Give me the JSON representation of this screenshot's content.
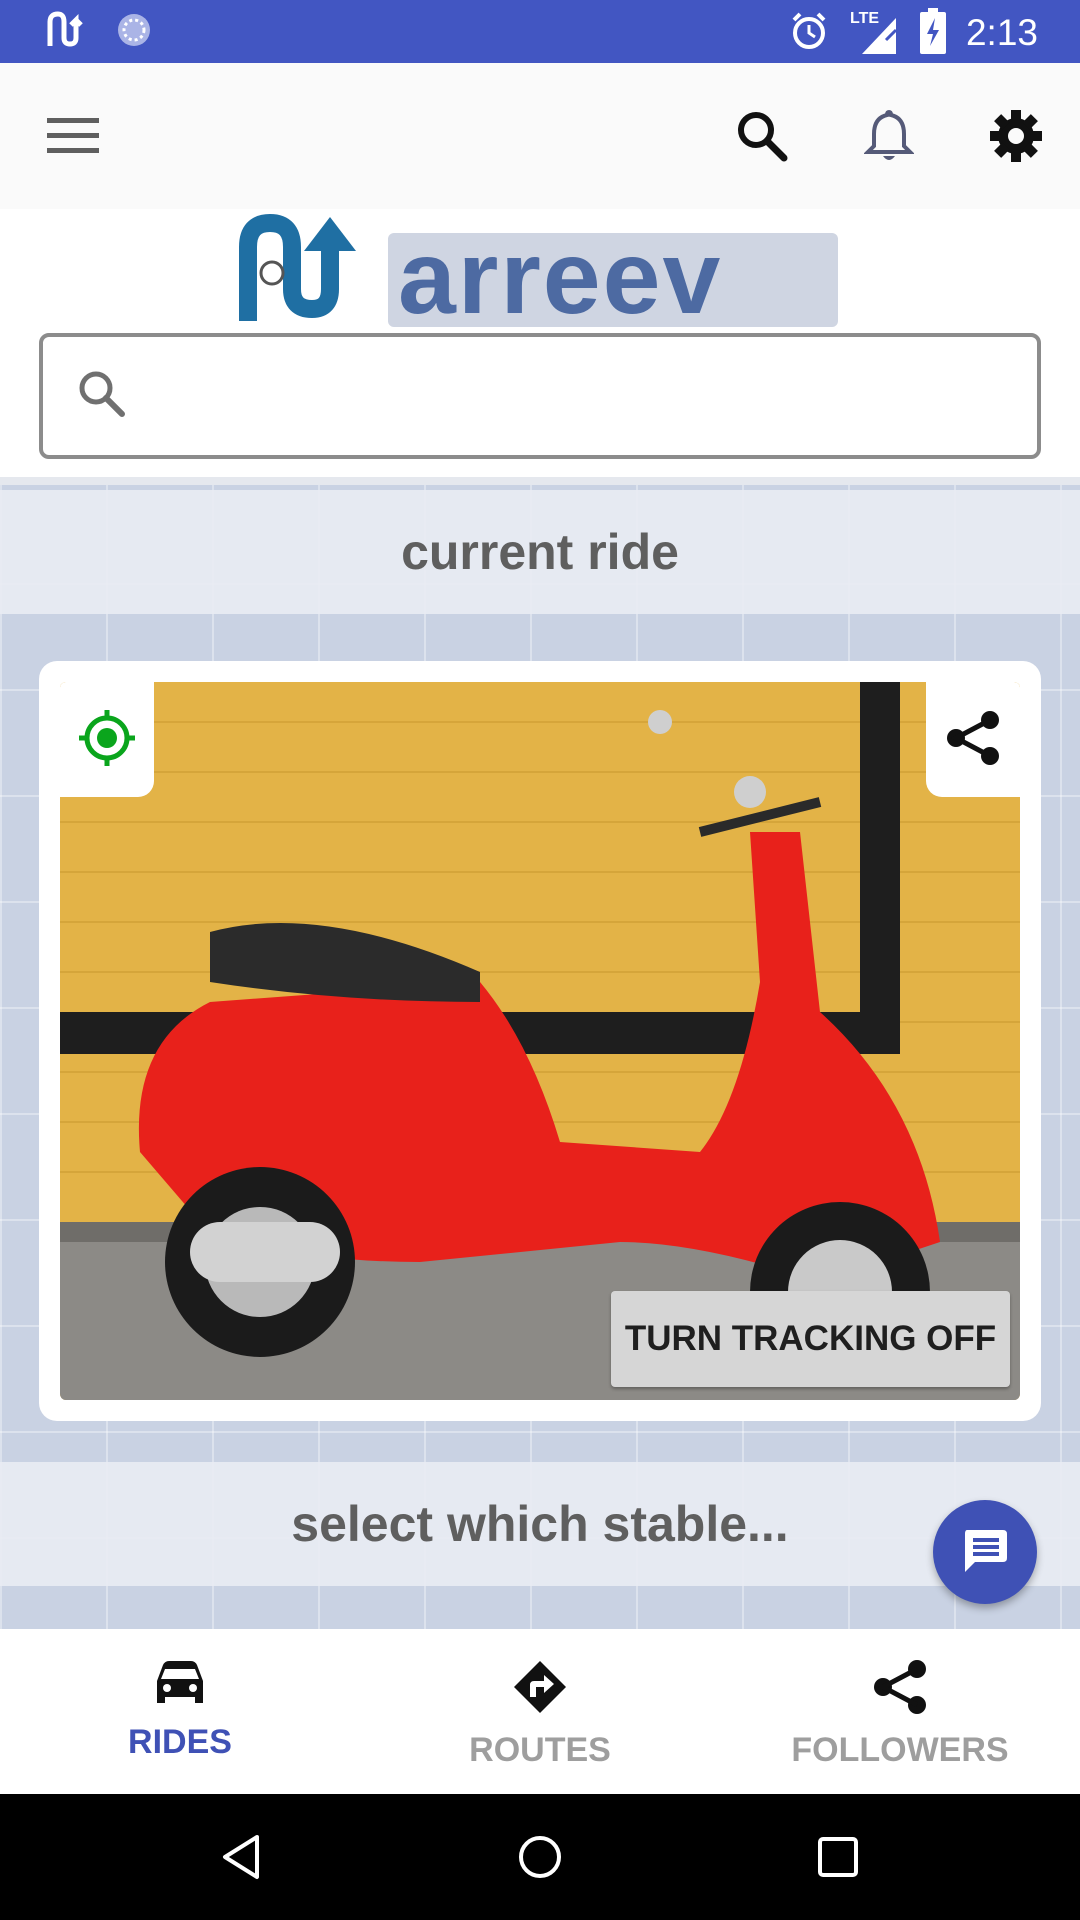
{
  "status_bar": {
    "time": "2:13",
    "network": "LTE",
    "icons": [
      "arreev-notification-icon",
      "sync-icon",
      "alarm-icon",
      "signal-icon",
      "battery-charging-icon"
    ]
  },
  "toolbar": {
    "icons": [
      "menu-icon",
      "search-icon",
      "bell-icon",
      "gear-icon"
    ]
  },
  "logo": {
    "text": "arreev"
  },
  "search": {
    "placeholder": "",
    "value": ""
  },
  "sections": {
    "current": "current ride",
    "select": "select which stable..."
  },
  "ride_card": {
    "photo_subject": "red scooter",
    "tracking_button": "TURN TRACKING OFF",
    "locate_icon": "gps-fixed-icon",
    "share_icon": "share-icon"
  },
  "fab": {
    "icon": "chat-icon"
  },
  "bottom_nav": {
    "items": [
      {
        "label": "RIDES",
        "icon": "car-icon",
        "active": true
      },
      {
        "label": "ROUTES",
        "icon": "directions-icon",
        "active": false
      },
      {
        "label": "FOLLOWERS",
        "icon": "share-icon",
        "active": false
      }
    ]
  },
  "colors": {
    "primary": "#3f51b5",
    "status_bar": "#4256c2",
    "locate_green": "#0aa51c"
  }
}
